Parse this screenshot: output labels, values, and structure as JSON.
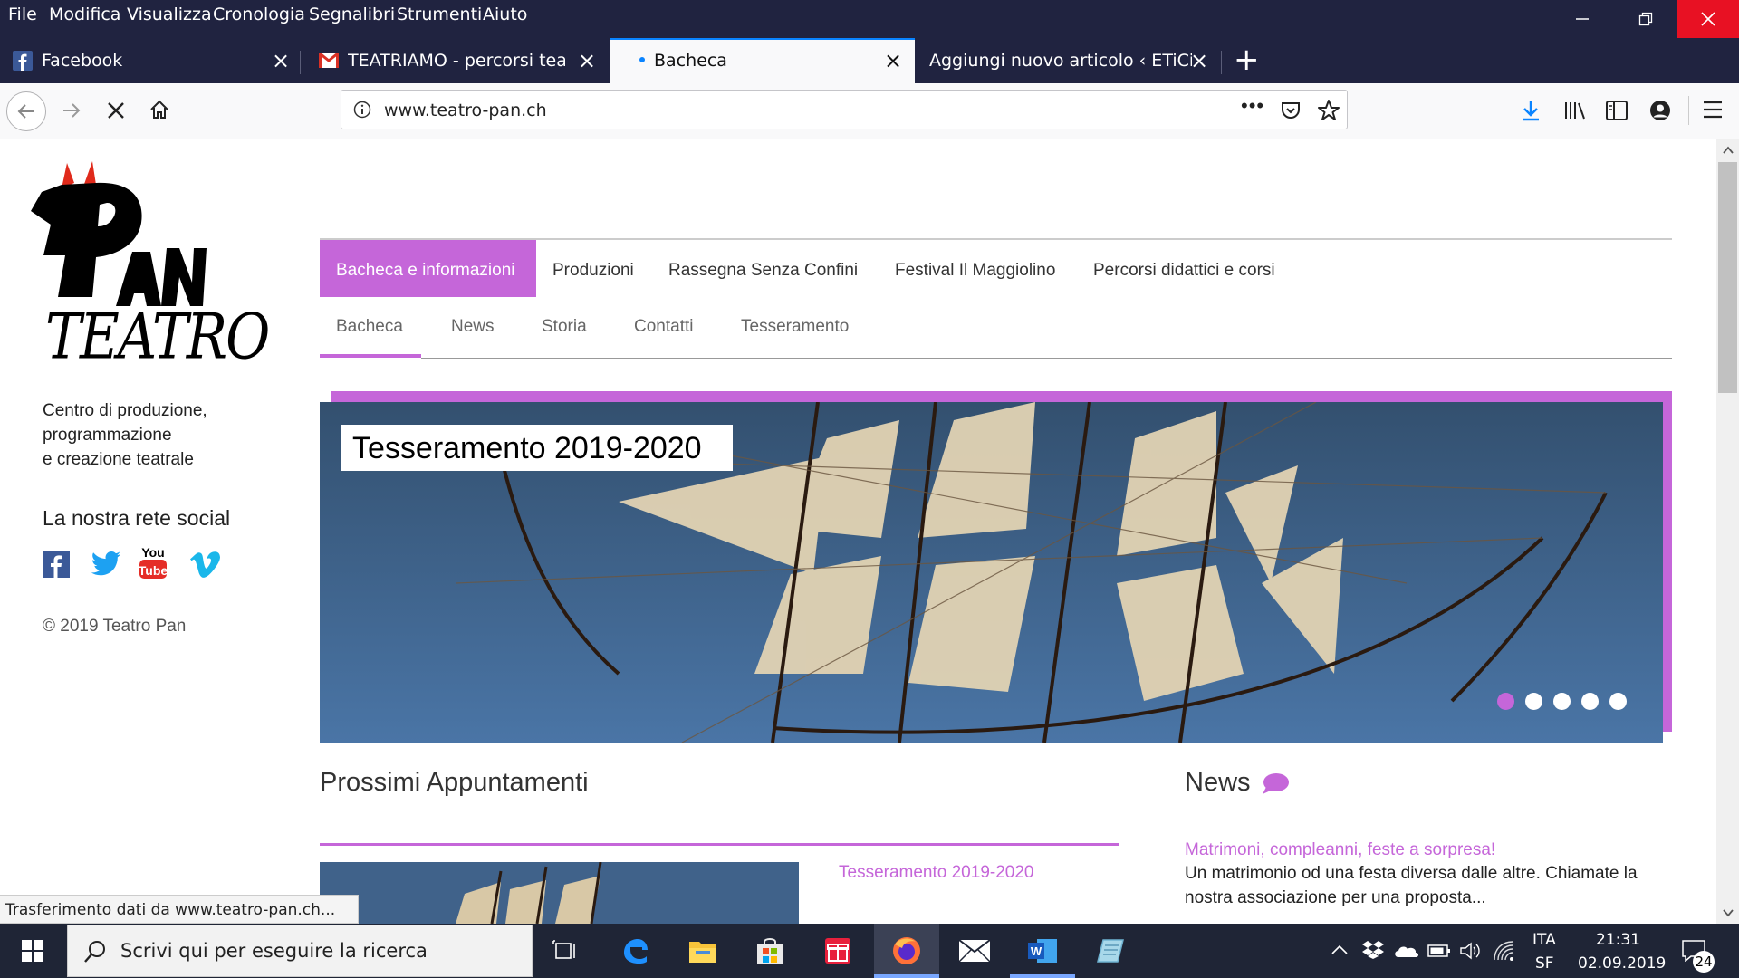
{
  "menu": {
    "items": [
      "File",
      "Modifica",
      "Visualizza",
      "Cronologia",
      "Segnalibri",
      "Strumenti",
      "Aiuto"
    ]
  },
  "tabs": [
    {
      "label": "Facebook"
    },
    {
      "label": "TEATRIAMO - percorsi teatrali c"
    },
    {
      "label": "Bacheca"
    },
    {
      "label": "Aggiungi nuovo articolo ‹ ETiCinfor"
    }
  ],
  "url": {
    "value": "www.teatro-pan.ch"
  },
  "site": {
    "logo_text_1": "PAN",
    "logo_text_2": "TEATRO",
    "tagline_1": "Centro di produzione,",
    "tagline_2": "programmazione",
    "tagline_3": "e creazione teatrale",
    "social_heading": "La nostra rete social",
    "copyright": "© 2019 Teatro Pan",
    "accent": "#c566d9"
  },
  "main_nav": [
    "Bacheca e informazioni",
    "Produzioni",
    "Rassegna Senza Confini",
    "Festival Il Maggiolino",
    "Percorsi didattici e corsi"
  ],
  "sub_nav": [
    "Bacheca",
    "News",
    "Storia",
    "Contatti",
    "Tesseramento"
  ],
  "hero": {
    "caption": "Tesseramento 2019-2020",
    "slides": 5,
    "active_slide": 1
  },
  "appointments": {
    "heading": "Prossimi Appuntamenti",
    "first_title": "Tesseramento 2019-2020"
  },
  "news": {
    "heading": "News",
    "item_title": "Matrimoni, compleanni, feste a sorpresa!",
    "item_text_1": "Un matrimonio od una festa diversa dalle altre.  Chiamate la",
    "item_text_2": "nostra associazione per una proposta..."
  },
  "status": {
    "text": "Trasferimento dati da www.teatro-pan.ch..."
  },
  "taskbar": {
    "search_placeholder": "Scrivi qui per eseguire la ricerca",
    "lang_1": "ITA",
    "lang_2": "SF",
    "time": "21:31",
    "date": "02.09.2019",
    "notifications": "24"
  }
}
